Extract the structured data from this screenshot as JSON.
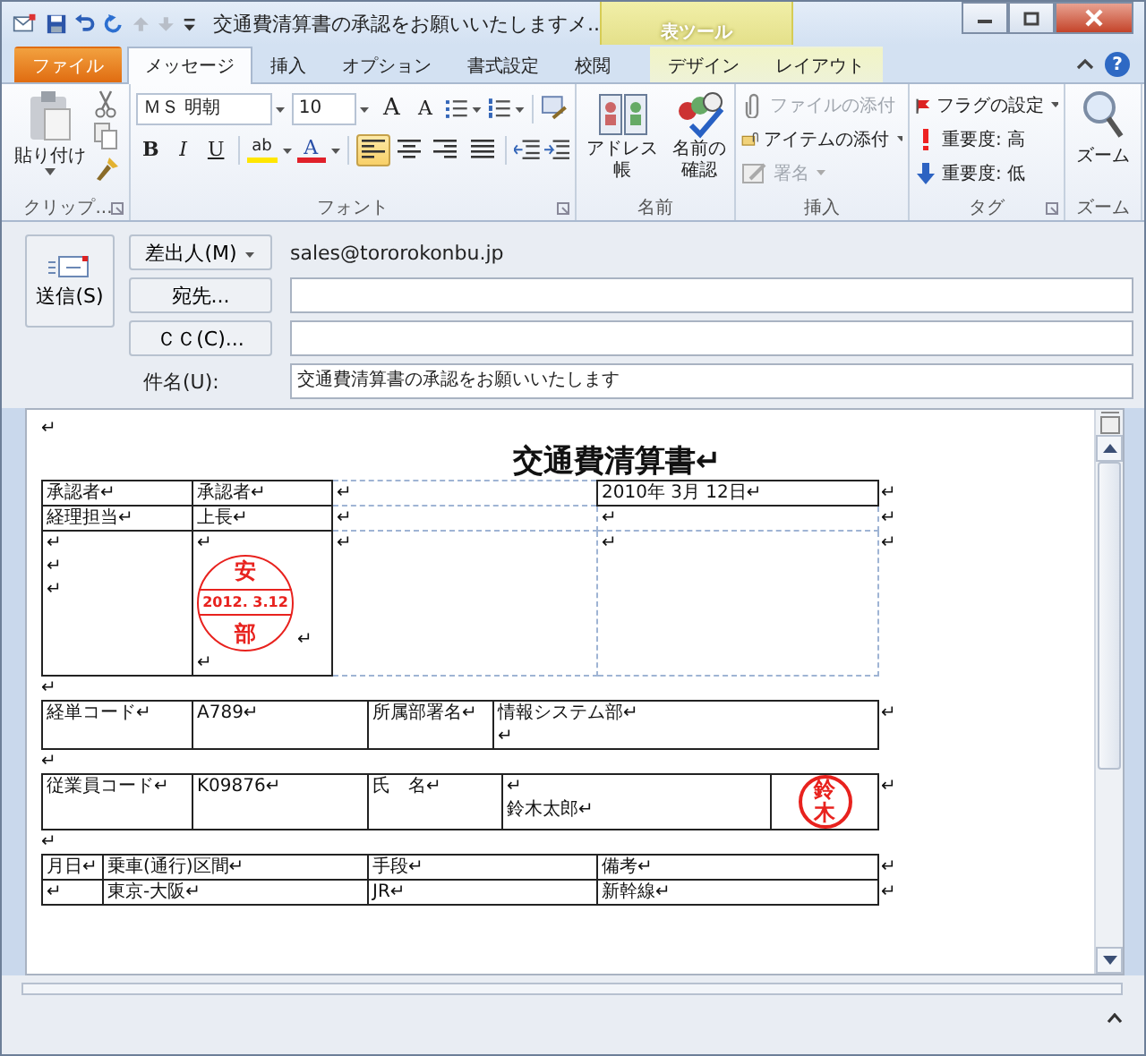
{
  "window": {
    "title": "交通費清算書の承認をお願いいたしますメ..",
    "context_label": "表ツール",
    "help": "?"
  },
  "tabs": [
    {
      "label": "ファイル",
      "kind": "file",
      "selected": false
    },
    {
      "label": "メッセージ",
      "kind": "normal",
      "selected": true
    },
    {
      "label": "挿入",
      "kind": "normal",
      "selected": false
    },
    {
      "label": "オプション",
      "kind": "normal",
      "selected": false
    },
    {
      "label": "書式設定",
      "kind": "normal",
      "selected": false
    },
    {
      "label": "校閲",
      "kind": "normal",
      "selected": false
    },
    {
      "label": "デザイン",
      "kind": "context",
      "selected": false
    },
    {
      "label": "レイアウト",
      "kind": "context",
      "selected": false
    }
  ],
  "ribbon": {
    "clipboard": {
      "label": "クリップ...",
      "paste": "貼り付け"
    },
    "font": {
      "label": "フォント",
      "font_name": "ＭＳ 明朝",
      "font_size": "10",
      "grow": "A",
      "shrink": "A",
      "bold": "B",
      "italic": "I",
      "underline": "U",
      "highlight": "ab",
      "font_color": "A",
      "align": [
        {
          "selected": true
        },
        {
          "selected": false
        },
        {
          "selected": false
        },
        {
          "selected": false
        }
      ]
    },
    "names": {
      "label": "名前",
      "buttons": [
        "アドレス帳",
        "名前の確認"
      ]
    },
    "include": {
      "label": "挿入",
      "items": [
        {
          "label": "ファイルの添付",
          "disabled": true,
          "dropdown": false
        },
        {
          "label": "アイテムの添付",
          "disabled": false,
          "dropdown": true
        },
        {
          "label": "署名",
          "disabled": true,
          "dropdown": true
        }
      ]
    },
    "tags": {
      "label": "タグ",
      "items": [
        {
          "label": "フラグの設定",
          "dropdown": true
        },
        {
          "label": "重要度: 高",
          "dropdown": false
        },
        {
          "label": "重要度: 低",
          "dropdown": false
        }
      ]
    },
    "zoom": {
      "label": "ズーム",
      "button": "ズーム"
    }
  },
  "header": {
    "send": "送信(S)",
    "from_button": "差出人(M)",
    "from_address": "sales@tororokonbu.jp",
    "to_button": "宛先...",
    "cc_button": "ＣＣ(C)...",
    "subject_label": "件名(U):",
    "subject": "交通費清算書の承認をお願いいたします"
  },
  "document": {
    "blocks": [
      {
        "kind": "para",
        "text": "↵"
      },
      {
        "kind": "title",
        "text": "交通費清算書↵"
      },
      {
        "kind": "table",
        "rows": [
          {
            "end": "↵",
            "cells": [
              {
                "text": "承認者↵",
                "ruled": true
              },
              {
                "text": "承認者↵",
                "ruled": true
              },
              {
                "text": "↵",
                "ruled": false
              },
              {
                "text": "2010年  3月  12日↵",
                "ruled": true
              }
            ]
          },
          {
            "end": "↵",
            "cells": [
              {
                "text": "経理担当↵",
                "ruled": true
              },
              {
                "text": "上長↵",
                "ruled": true
              },
              {
                "text": "↵",
                "ruled": false
              },
              {
                "text": "↵",
                "ruled": false
              }
            ]
          },
          {
            "end": "↵",
            "cells": [
              {
                "text": "↵\n↵\n↵",
                "ruled": true
              },
              {
                "text": "↵",
                "ruled": true,
                "stamp": {
                  "kind": "date",
                  "top": "安",
                  "date": "2012. 3.12",
                  "bottom": "部"
                },
                "stamp_mark": "↵",
                "after": "↵"
              },
              {
                "text": "↵",
                "ruled": false
              },
              {
                "text": "↵",
                "ruled": false
              }
            ]
          }
        ]
      },
      {
        "kind": "para",
        "text": "↵"
      },
      {
        "kind": "table",
        "rows": [
          {
            "end": "↵",
            "cells": [
              {
                "text": "経単コード↵",
                "ruled": true
              },
              {
                "text": "A789↵",
                "ruled": true
              },
              {
                "text": "所属部署名↵",
                "ruled": true
              },
              {
                "text": "情報システム部↵\n↵",
                "ruled": true
              }
            ]
          }
        ]
      },
      {
        "kind": "para",
        "text": "↵"
      },
      {
        "kind": "table",
        "rows": [
          {
            "end": "↵",
            "cells": [
              {
                "text": "従業員コード↵",
                "ruled": true
              },
              {
                "text": "K09876↵",
                "ruled": true
              },
              {
                "text": "氏　名↵",
                "ruled": true
              },
              {
                "text": "↵\n鈴木太郎↵",
                "ruled": true
              },
              {
                "text": "",
                "ruled": true,
                "stamp": {
                  "kind": "name",
                  "chars": [
                    "鈴",
                    "木"
                  ]
                }
              }
            ]
          }
        ]
      },
      {
        "kind": "para",
        "text": "↵"
      },
      {
        "kind": "table",
        "rows": [
          {
            "end": "↵",
            "cells": [
              {
                "text": "月日↵",
                "ruled": true
              },
              {
                "text": "乗車(通行)区間↵",
                "ruled": true
              },
              {
                "text": "手段↵",
                "ruled": true
              },
              {
                "text": "備考↵",
                "ruled": true
              }
            ]
          },
          {
            "end": "↵",
            "cells": [
              {
                "text": "↵",
                "ruled": true
              },
              {
                "text": "東京-大阪↵",
                "ruled": true
              },
              {
                "text": "JR↵",
                "ruled": true
              },
              {
                "text": "新幹線↵",
                "ruled": true
              }
            ]
          }
        ]
      }
    ]
  }
}
